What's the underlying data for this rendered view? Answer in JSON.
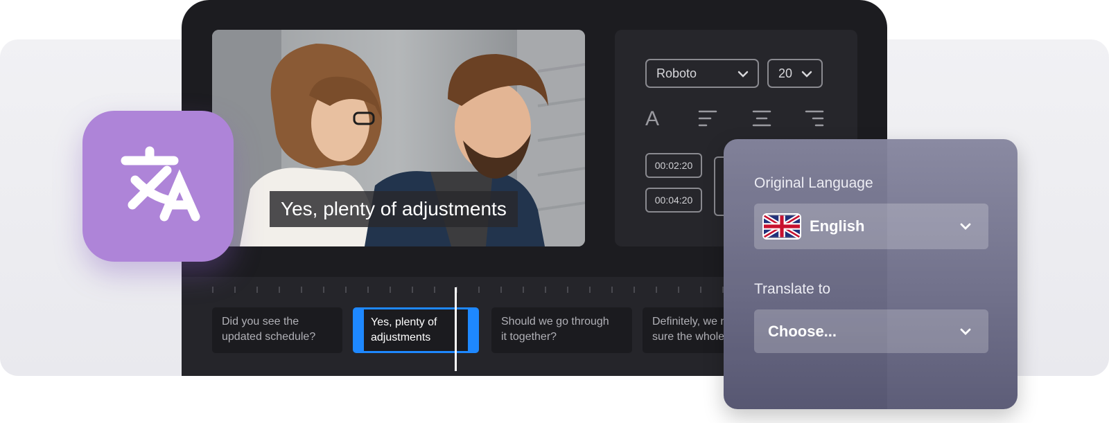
{
  "video": {
    "subtitle_overlay": "Yes, plenty of adjustments"
  },
  "style_panel": {
    "font_family": "Roboto",
    "font_size": "20",
    "text_icon": "A",
    "icons": [
      "text-style-icon",
      "align-left-icon",
      "align-center-icon",
      "align-right-icon",
      "chevron-down-icon"
    ],
    "start_time": "00:02:20",
    "end_time": "00:04:20"
  },
  "timeline": {
    "clips": [
      {
        "line1": "Did you see the",
        "line2": "updated schedule?"
      },
      {
        "line1": "Yes, plenty of",
        "line2": "adjustments"
      },
      {
        "line1": "Should we go through",
        "line2": "it together?"
      },
      {
        "line1": "Definitely, we n",
        "line2": "sure the whole"
      }
    ],
    "active_clip_index": 1
  },
  "translate_card": {
    "original_label": "Original Language",
    "original_value": "English",
    "target_label": "Translate to",
    "target_placeholder": "Choose...",
    "flag_icon": "uk-flag-icon"
  },
  "app_icon": {
    "icon": "translate-icon",
    "color": "#ae84d8"
  },
  "colors": {
    "editor_bg": "#1c1c20",
    "accent": "#1e88ff",
    "card_bg": "#7a7a94"
  }
}
